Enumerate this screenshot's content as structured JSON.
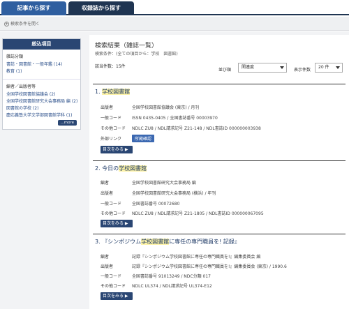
{
  "tabs": {
    "article": "記事から探す",
    "magazine": "収録誌から探す"
  },
  "options": {
    "link": "検索条件を開く"
  },
  "sidebar": {
    "title": "絞込項目",
    "classification": {
      "heading": "雑誌分類",
      "items": [
        "書誌・図書館・一般年鑑 (14)",
        "教育 (1)"
      ]
    },
    "publisher": {
      "heading": "編者／出版者等",
      "items": [
        "全国学校図書館協議会 (2)",
        "全国学校図書館研究大会事務局 編 (2)",
        "図書館の学校 (2)",
        "慶応義塾大学文学部図書館学科 (1)"
      ],
      "more": "...more"
    }
  },
  "results": {
    "title": "検索結果（雑誌一覧）",
    "condition": "検索条件：(全ての項目から：学校　図書館)",
    "count": "該当件数：15件",
    "sort_label": "並び順",
    "sort_value": "関連度",
    "count_label": "表示件数",
    "count_value": "20 件",
    "items": [
      {
        "num": "1.",
        "title_hl": "学校図書館",
        "title_after": "",
        "rows": [
          {
            "label": "出版者",
            "value": "全国学校図書館協議会 (東京) / 月刊"
          },
          {
            "label": "一般コード",
            "value": "ISSN 0435-0405 / 全国書誌番号 00003970"
          },
          {
            "label": "その他コード",
            "value": "NDLC ZU8 / NDL請求記号 Z21-148 / NDL書誌ID 000000003938"
          },
          {
            "label": "外部リンク",
            "value": "所蔵確認"
          }
        ],
        "button": "目次をみる ▶"
      },
      {
        "num": "2.",
        "title_before": "今日の",
        "title_hl": "学校図書館",
        "rows": [
          {
            "label": "編者",
            "value": "全国学校図書館研究大会事務局 編"
          },
          {
            "label": "出版者",
            "value": "全国学校図書館研究大会事務局 (横浜) / 年刊"
          },
          {
            "label": "一般コード",
            "value": "全国書誌番号 00072680"
          },
          {
            "label": "その他コード",
            "value": "NDLC ZU8 / NDL請求記号 Z21-1805 / NDL書誌ID 000000067095"
          }
        ],
        "button": "目次をみる ▶"
      },
      {
        "num": "3.",
        "title_before": "『シンポジウム",
        "title_hl": "学校図書館",
        "title_after": "に専任の専門職員を! 記録』",
        "rows": [
          {
            "label": "編者",
            "value": "記録『シンポジウム学校図書館に専任の専門職員を!』編集委員会 編"
          },
          {
            "label": "出版者",
            "value": "記録『シンポジウム学校図書館に専任の専門職員を!』編集委員会 (東京) / 1990.6"
          },
          {
            "label": "一般コード",
            "value": "全国書誌番号 91013249 / NDC分類 017"
          },
          {
            "label": "その他コード",
            "value": "NDLC UL374 / NDL請求記号 UL374-E12"
          }
        ],
        "button": "目次をみる ▶"
      }
    ]
  }
}
